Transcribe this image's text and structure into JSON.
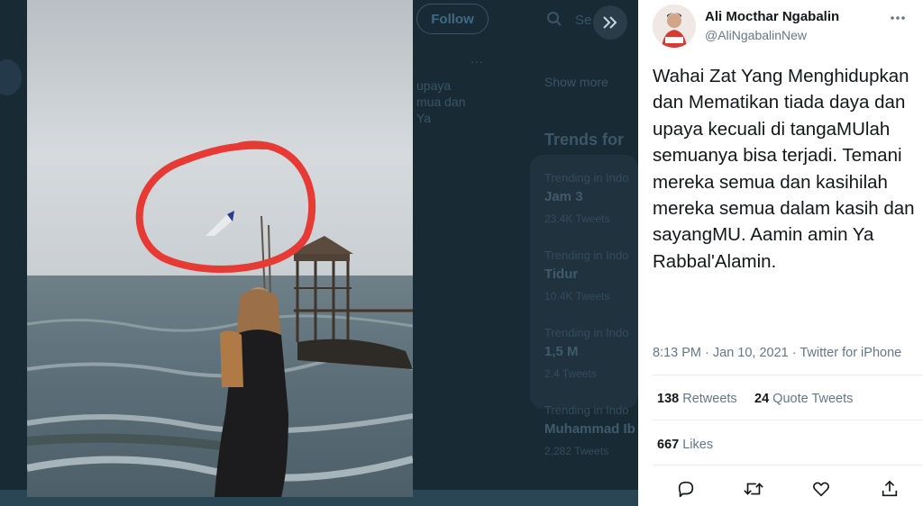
{
  "background_page": {
    "follow_label": "Follow",
    "search_placeholder": "Se",
    "tweet_fragment_lines": [
      "upaya",
      "mua dan",
      "Ya"
    ],
    "show_more_label": "Show more",
    "trends_title": "Trends for",
    "trends": [
      {
        "category": "Trending in Indo",
        "name": "Jam 3",
        "count": "23.4K Tweets"
      },
      {
        "category": "Trending in Indo",
        "name": "Tidur",
        "count": "10.4K Tweets"
      },
      {
        "category": "Trending in Indo",
        "name": "1,5 M",
        "count": "2.4 Tweets"
      },
      {
        "category": "Trending in Indo",
        "name": "Muhammad Ib",
        "count": "2,282 Tweets"
      }
    ]
  },
  "photo": {
    "description_icon": "photo-woman-at-sea-with-circled-plane"
  },
  "tweet": {
    "display_name": "Ali Mocthar Ngabalin",
    "handle": "@AliNgabalinNew",
    "text": "Wahai Zat Yang Menghidupkan dan Mematikan tiada daya dan upaya kecuali di tangaMUlah semuanya bisa terjadi. Temani mereka semua dan kasihilah mereka semua dalam kasih dan sayangMU. Aamin amin Ya Rabbal'Alamin.",
    "time": "8:13 PM · Jan 10, 2021",
    "client": "Twitter for iPhone",
    "retweets_count": "138",
    "retweets_label": "Retweets",
    "quotes_count": "24",
    "quotes_label": "Quote Tweets",
    "likes_count": "667",
    "likes_label": "Likes",
    "actions": [
      "reply-icon",
      "retweet-icon",
      "like-icon",
      "share-icon"
    ]
  },
  "colors": {
    "text_primary": "#14171a",
    "text_secondary": "#657786",
    "divider": "#e6ecf0",
    "annotation_red": "#e83a35"
  }
}
